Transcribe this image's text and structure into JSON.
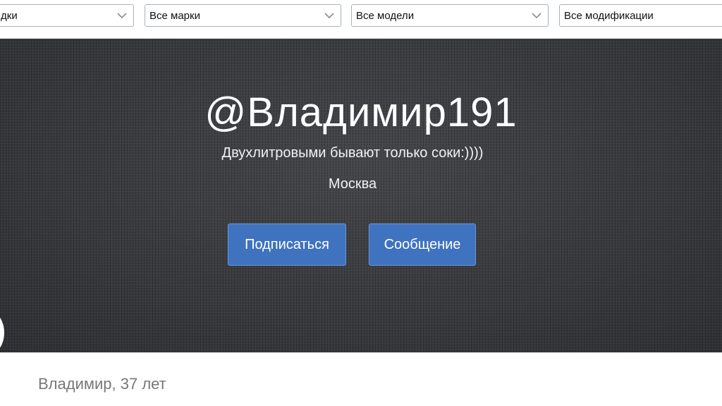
{
  "filters": [
    {
      "value": "дки"
    },
    {
      "value": "Все марки"
    },
    {
      "value": "Все модели"
    },
    {
      "value": "Все модификации"
    }
  ],
  "profile": {
    "username": "@Владимир191",
    "status": "Двухлитровыми бывают только соки:))))",
    "city": "Москва",
    "name_age": "Владимир, 37 лет"
  },
  "actions": {
    "subscribe_label": "Подписаться",
    "message_label": "Сообщение"
  },
  "colors": {
    "button_blue": "#3f73c0",
    "hero_background": "#3a3b3e"
  },
  "icons": {
    "select_arrow": "chevron-down-icon"
  }
}
